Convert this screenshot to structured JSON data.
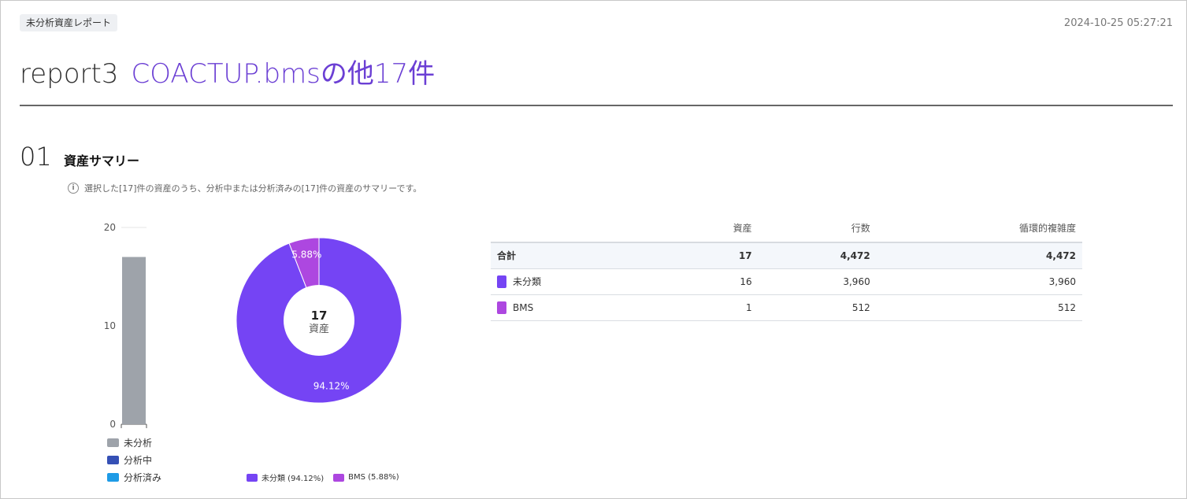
{
  "header": {
    "badge": "未分析資産レポート",
    "timestamp": "2024-10-25 05:27:21",
    "title_main": "report3",
    "title_sub": "COACTUP.bmsの他17件"
  },
  "section": {
    "number": "01",
    "title": "資産サマリー",
    "info_icon": "info-icon",
    "info_text": "選択した[17]件の資産のうち、分析中または分析済みの[17]件の資産のサマリーです。"
  },
  "colors": {
    "unanalyzed": "#9ea3aa",
    "analyzing": "#3550b5",
    "analyzed": "#1e9be6",
    "unclassified": "#7544f4",
    "bms": "#ad47e0"
  },
  "chart_data": [
    {
      "type": "bar",
      "categories": [
        ""
      ],
      "series": [
        {
          "name": "未分析",
          "values": [
            17
          ]
        },
        {
          "name": "分析中",
          "values": [
            0
          ]
        },
        {
          "name": "分析済み",
          "values": [
            0
          ]
        }
      ],
      "stacked": true,
      "ylim": [
        0,
        20
      ],
      "yticks": [
        "0",
        "10",
        "20"
      ],
      "legend": "bottom"
    },
    {
      "type": "pie",
      "donut": true,
      "labels": [
        "未分類",
        "BMS"
      ],
      "values": [
        16,
        1
      ],
      "slice_labels": [
        "94.12%",
        "5.88%"
      ],
      "legend_labels": [
        "未分類 (94.12%)",
        "BMS (5.88%)"
      ],
      "center_value": "17",
      "center_label": "資産",
      "legend": "bottom"
    }
  ],
  "table": {
    "headers": [
      "",
      "資産",
      "行数",
      "循環的複雑度"
    ],
    "total": {
      "label": "合計",
      "assets": "17",
      "lines": "4,472",
      "complexity": "4,472"
    },
    "rows": [
      {
        "label": "未分類",
        "assets": "16",
        "lines": "3,960",
        "complexity": "3,960"
      },
      {
        "label": "BMS",
        "assets": "1",
        "lines": "512",
        "complexity": "512"
      }
    ]
  }
}
